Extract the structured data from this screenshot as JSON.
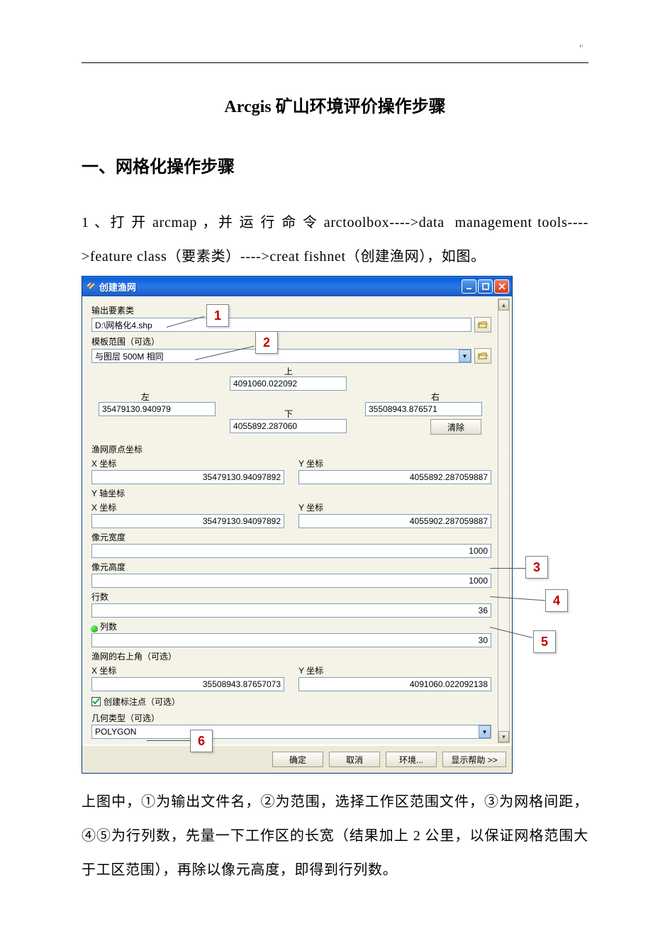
{
  "doc": {
    "topmark": "'`",
    "title": "Arcgis 矿山环境评价操作步骤",
    "section1": "一、网格化操作步骤",
    "para1_a": "1 、打 开 arcmap ，并 运 行 命 令 arctoolbox---->data  management tools---->feature class（要素类）---->creat fishnet（创建渔网），如图。",
    "body2_a": "上图中，①为输出文件名，②为范围，选择工作区范围文件，③为网格间距，④⑤为行列数，先量一下工作区的长宽（结果加上 2 公里，以保证网格范围大于工区范围），再除以像元高度，即得到行列数。"
  },
  "window": {
    "title": "创建渔网",
    "labels": {
      "output_fc": "输出要素类",
      "template": "模板范围（可选）",
      "top": "上",
      "left": "左",
      "right": "右",
      "bottom": "下",
      "clear": "清除",
      "origin": "渔网原点坐标",
      "xcoord": "X 坐标",
      "ycoord": "Y 坐标",
      "yaxis": "Y 轴坐标",
      "cell_w": "像元宽度",
      "cell_h": "像元高度",
      "rows": "行数",
      "cols": "列数",
      "opposite": "渔网的右上角（可选）",
      "create_labels": "创建标注点（可选）",
      "geom_type": "几何类型（可选）"
    },
    "values": {
      "output_fc": "D:\\网格化4.shp",
      "template": "与图层 500M 相同",
      "top": "4091060.022092",
      "left": "35479130.940979",
      "right": "35508943.876571",
      "bottom": "4055892.287060",
      "origin_x": "35479130.94097892",
      "origin_y": "4055892.287059887",
      "yaxis_x": "35479130.94097892",
      "yaxis_y": "4055902.287059887",
      "cell_w": "1000",
      "cell_h": "1000",
      "rows": "36",
      "cols": "30",
      "opp_x": "35508943.87657073",
      "opp_y": "4091060.022092138",
      "geom_type": "POLYGON"
    },
    "buttons": {
      "ok": "确定",
      "cancel": "取消",
      "env": "环境...",
      "help": "显示帮助 >>"
    }
  },
  "callouts": {
    "c1": "1",
    "c2": "2",
    "c3": "3",
    "c4": "4",
    "c5": "5",
    "c6": "6"
  }
}
